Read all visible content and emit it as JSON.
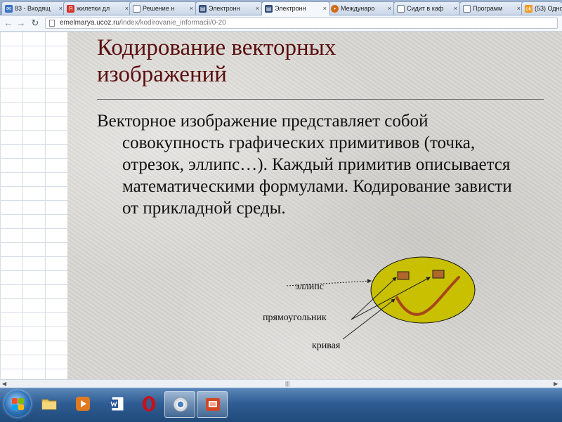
{
  "browser": {
    "tabs": [
      {
        "label": "83 - Входящ",
        "icon": "mail-icon",
        "color": "#3a6fc4",
        "active": false
      },
      {
        "label": "жилетки дл",
        "icon": "yandex-icon",
        "color": "#d4322b",
        "active": false
      },
      {
        "label": "Решение н",
        "icon": "page-icon",
        "color": "#6f7c8e",
        "active": false
      },
      {
        "label": "Электронн",
        "icon": "book-icon",
        "color": "#2f4a78",
        "active": false
      },
      {
        "label": "Электронн",
        "icon": "book-icon",
        "color": "#2f4a78",
        "active": true
      },
      {
        "label": "Междунаро",
        "icon": "paw-icon",
        "color": "#d06a1a",
        "active": false
      },
      {
        "label": "Сидит в каф",
        "icon": "page-icon",
        "color": "#6f7c8e",
        "active": false
      },
      {
        "label": "Программ",
        "icon": "page-icon",
        "color": "#6f7c8e",
        "active": false
      },
      {
        "label": "(53) Одно",
        "icon": "ok-icon",
        "color": "#f09a1a",
        "active": false
      }
    ],
    "tab_close_glyph": "×",
    "url_host": "emelmarya.ucoz.ru",
    "url_path": "/index/kodirovanie_informacii/0-20"
  },
  "slide": {
    "title_line1": "Кодирование векторных",
    "title_line2": "изображений",
    "body": "Векторное изображение представляет собой совокупность графических примитивов (точка, отрезок, эллипс…). Каждый примитив описывается математическими формулами. Кодирование зависти от прикладной среды.",
    "diagram": {
      "label_ellipse": "эллипс",
      "label_rectangle": "прямоугольник",
      "label_curve": "кривая",
      "face_color": "#c8c000",
      "rect_color": "#b0672a",
      "curve_color": "#a7461c"
    }
  },
  "taskbar": {
    "apps": [
      {
        "name": "folder-icon",
        "active": false
      },
      {
        "name": "media-player-icon",
        "active": false
      },
      {
        "name": "word-icon",
        "active": false
      },
      {
        "name": "opera-icon",
        "active": false
      },
      {
        "name": "chrome-icon",
        "active": true
      },
      {
        "name": "powerpoint-icon",
        "active": true
      }
    ]
  }
}
